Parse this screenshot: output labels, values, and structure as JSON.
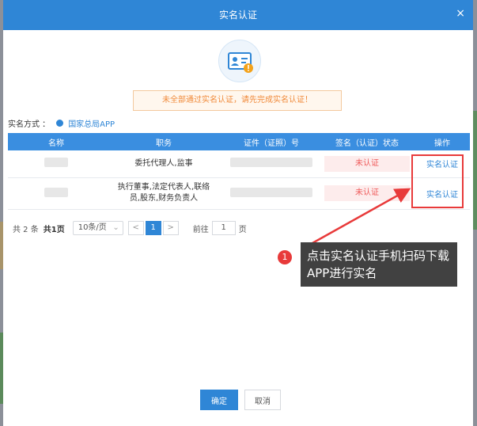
{
  "dialog": {
    "title": "实名认证",
    "close_label": "×",
    "warning": "未全部通过实名认证，请先完成实名认证！",
    "method_label": "实名方式 ：",
    "method_value": "国家总局APP"
  },
  "table": {
    "headers": [
      "名称",
      "职务",
      "证件（证照）号",
      "签名（认证）状态",
      "操作"
    ],
    "rows": [
      {
        "role": "委托代理人,监事",
        "status": "未认证",
        "action": "实名认证"
      },
      {
        "role_line1": "执行董事,法定代表人,联络",
        "role_line2": "员,股东,财务负责人",
        "status": "未认证",
        "action": "实名认证"
      }
    ]
  },
  "pager": {
    "total": "共 2 条",
    "pages": "共1页",
    "page_size": "10条/页",
    "prev": "<",
    "current": "1",
    "next": ">",
    "goto_prefix": "前往",
    "goto_value": "1",
    "goto_suffix": "页"
  },
  "annotation": {
    "number": "1",
    "line1": "点击实名认证手机扫码下载",
    "line2": "APP进行实名",
    "color": "#e83a3a"
  },
  "buttons": {
    "confirm": "确定",
    "cancel": "取消"
  },
  "colors": {
    "header": "#2f86d6",
    "table_header": "#3a8ee0",
    "warning_text": "#f08a3a",
    "status_text": "#ef5a5a"
  }
}
